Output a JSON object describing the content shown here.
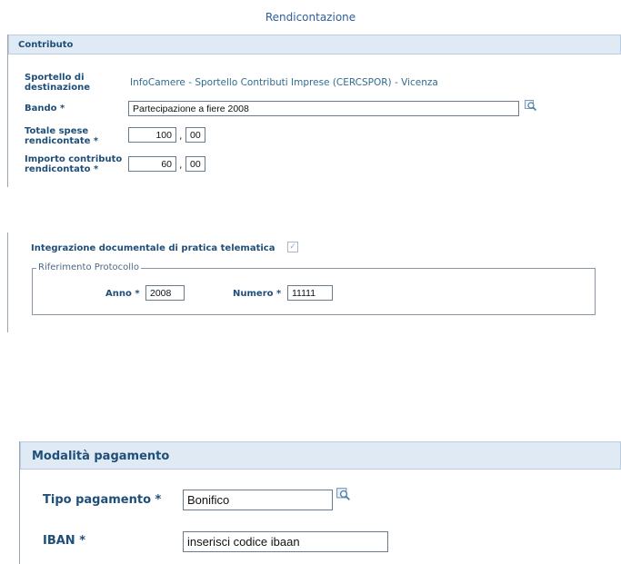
{
  "page_title": "Rendicontazione",
  "contributo": {
    "header": "Contributo",
    "sportello_label": "Sportello di destinazione",
    "sportello_value": "InfoCamere - Sportello Contributi Imprese (CERCSPOR) - Vicenza",
    "bando_label": "Bando *",
    "bando_value": "Partecipazione a fiere 2008",
    "totale_label": "Totale spese rendicontate *",
    "totale_int": "100",
    "totale_dec": "00",
    "importo_label": "Importo contributo rendicontato *",
    "importo_int": "60",
    "importo_dec": "00",
    "decimal_sep": ","
  },
  "integrazione": {
    "label": "Integrazione documentale di pratica telematica",
    "checked": true,
    "fieldset_legend": "Riferimento Protocollo",
    "anno_label": "Anno *",
    "anno_value": "2008",
    "numero_label": "Numero *",
    "numero_value": "11111"
  },
  "pagamento": {
    "header": "Modalità pagamento",
    "tipo_label": "Tipo pagamento *",
    "tipo_value": "Bonifico",
    "iban_label": "IBAN *",
    "iban_value": "inserisci codice ibaan"
  },
  "icons": {
    "lookup": "magnifier-lookup-icon",
    "checkbox": "checkmark-icon"
  }
}
